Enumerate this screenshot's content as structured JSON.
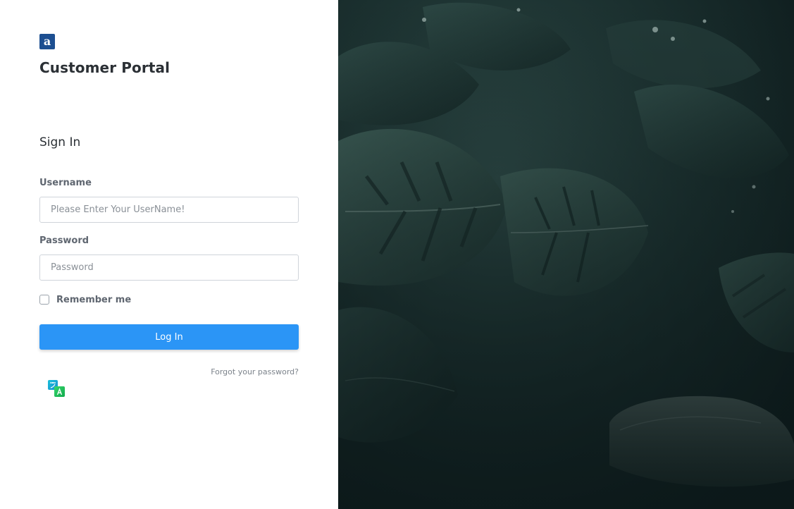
{
  "brand": {
    "logo_letter": "a",
    "app_title": "Customer Portal"
  },
  "form": {
    "heading": "Sign In",
    "username_label": "Username",
    "username_placeholder": "Please Enter Your UserName!",
    "username_value": "",
    "password_label": "Password",
    "password_placeholder": "Password",
    "password_value": "",
    "remember_label": "Remember me",
    "remember_checked": false,
    "login_label": "Log In",
    "forgot_label": "Forgot your password?"
  },
  "icons": {
    "logo": "brand-logo-icon",
    "language": "translate-icon"
  },
  "colors": {
    "brand": "#1d4f91",
    "primary_button": "#2b95f6",
    "background_image_tone": "#1c3433"
  }
}
